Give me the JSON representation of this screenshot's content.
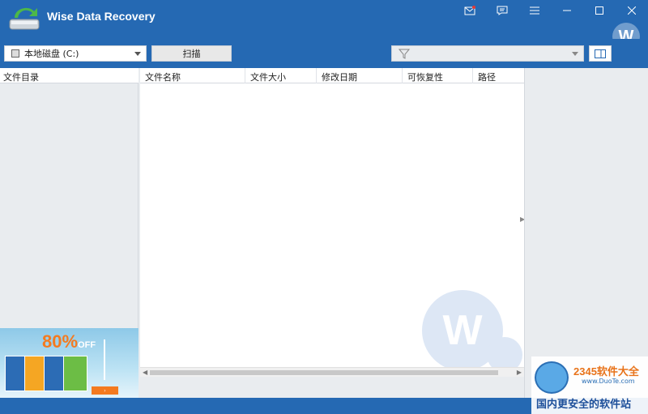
{
  "app": {
    "title": "Wise Data Recovery",
    "avatar_letter": "W"
  },
  "window_controls": [
    "mail-icon",
    "feedback-icon",
    "menu-icon",
    "minimize-icon",
    "maximize-icon",
    "close-icon"
  ],
  "toolbar": {
    "drive_value": "本地磁盘 (C:)",
    "scan_label": "扫描",
    "filter_value": ""
  },
  "tree": {
    "header": "文件目录"
  },
  "list": {
    "columns": [
      "文件名称",
      "文件大小",
      "修改日期",
      "可恢复性",
      "路径"
    ],
    "rows": []
  },
  "watermark": {
    "letter": "W"
  },
  "ad": {
    "discount": "80%",
    "off": "OFF"
  },
  "site_watermark": {
    "brand": "2345软件大全",
    "url": "www.DuoTe.com",
    "slogan": "国内更安全的软件站"
  },
  "colors": {
    "primary": "#2569b3",
    "panel": "#e9ecef",
    "accent": "#f47a1f"
  }
}
